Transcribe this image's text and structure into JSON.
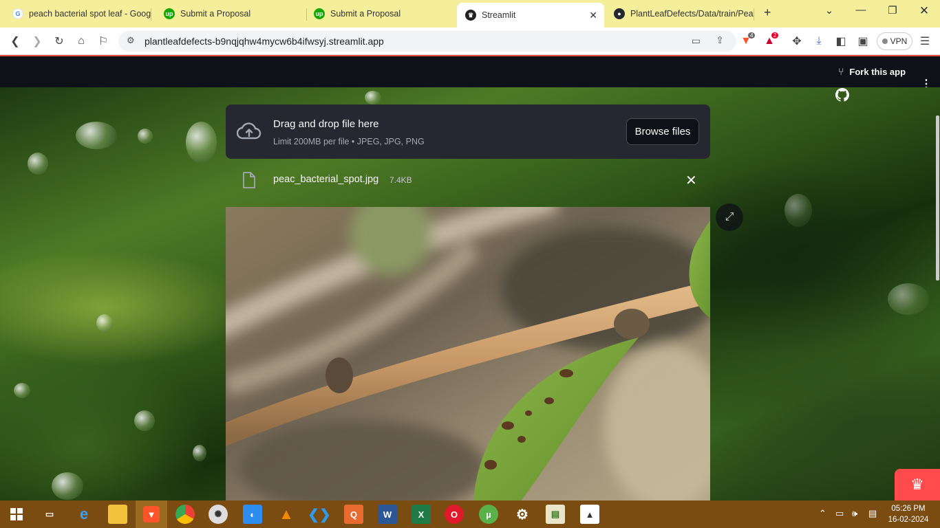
{
  "browser": {
    "tabs": [
      {
        "label": "peach bacterial spot leaf - Google",
        "icon": "google-icon"
      },
      {
        "label": "Submit a Proposal",
        "icon": "upwork-icon"
      },
      {
        "label": "Submit a Proposal",
        "icon": "upwork-icon"
      },
      {
        "label": "Streamlit",
        "icon": "streamlit-icon",
        "active": true
      },
      {
        "label": "PlantLeafDefects/Data/train/Peach",
        "icon": "github-icon"
      }
    ],
    "url": "plantleafdefects-b9nqjqhw4mycw6b4ifwsyj.streamlit.app",
    "brave_badge": "4",
    "rewards_badge": "2",
    "vpn_label": "VPN"
  },
  "app": {
    "fork_label": "Fork this app",
    "uploader": {
      "title": "Drag and drop file here",
      "subtitle": "Limit 200MB per file • JPEG, JPG, PNG",
      "browse_label": "Browse files"
    },
    "file": {
      "name": "peac_bacterial_spot.jpg",
      "size": "7.4KB"
    }
  },
  "taskbar": {
    "time": "05:26 PM",
    "date": "16-02-2024"
  },
  "colors": {
    "tabstrip": "#f5ef9b",
    "app_header": "#0e1117",
    "uploader_bg": "#262730",
    "accent": "#ff4b4b",
    "taskbar": "#7a4c12"
  }
}
